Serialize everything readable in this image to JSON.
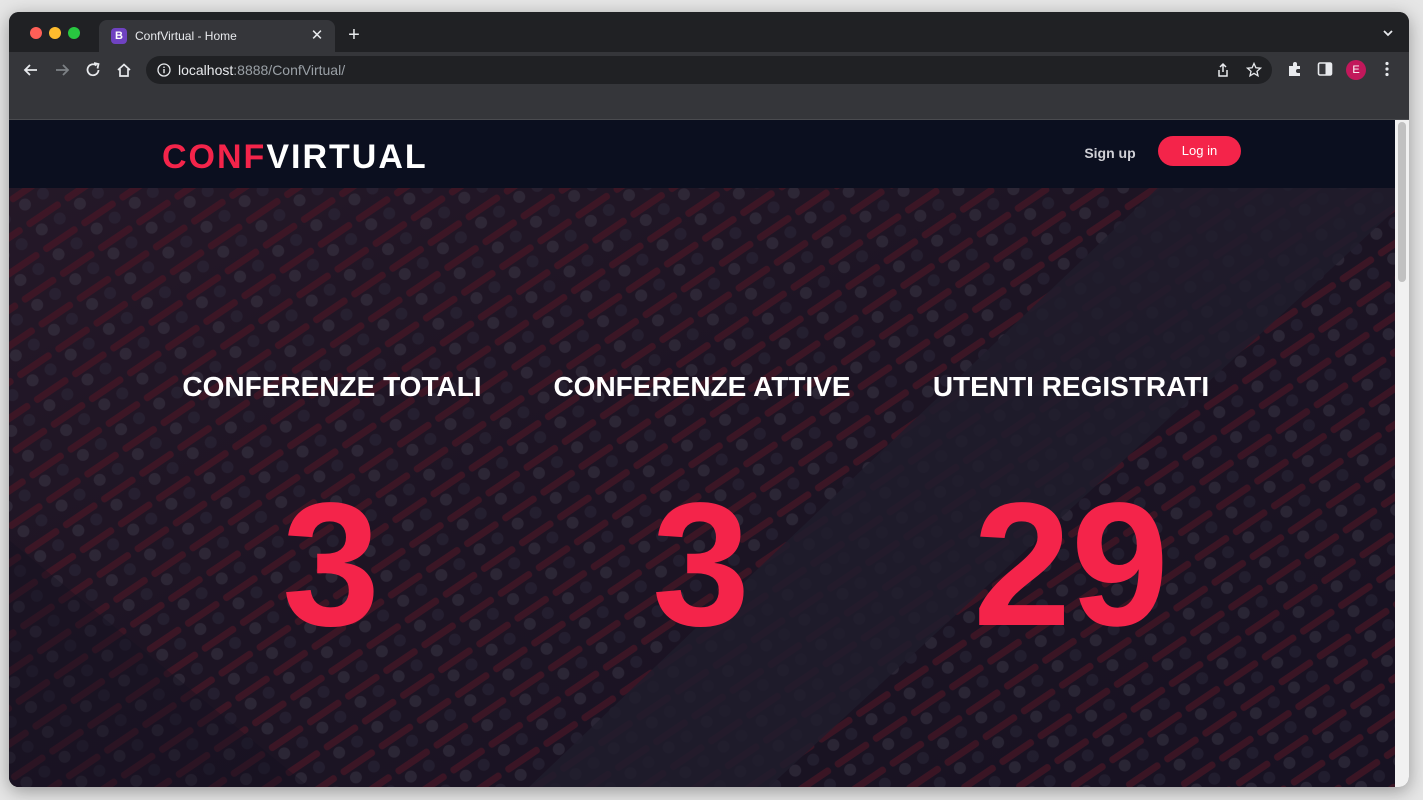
{
  "browser": {
    "tab_title": "ConfVirtual - Home",
    "favicon_letter": "B",
    "url_host": "localhost",
    "url_rest": ":8888/ConfVirtual/",
    "profile_initial": "E"
  },
  "site": {
    "logo_part1": "CONF",
    "logo_part2": "VIRTUAL",
    "signup_label": "Sign up",
    "login_label": "Log in",
    "accent_color": "#f4244a",
    "nav_color": "#0b0f1f"
  },
  "stats": [
    {
      "label": "CONFERENZE TOTALI",
      "value": "3"
    },
    {
      "label": "CONFERENZE ATTIVE",
      "value": "3"
    },
    {
      "label": "UTENTI REGISTRATI",
      "value": "29"
    }
  ]
}
